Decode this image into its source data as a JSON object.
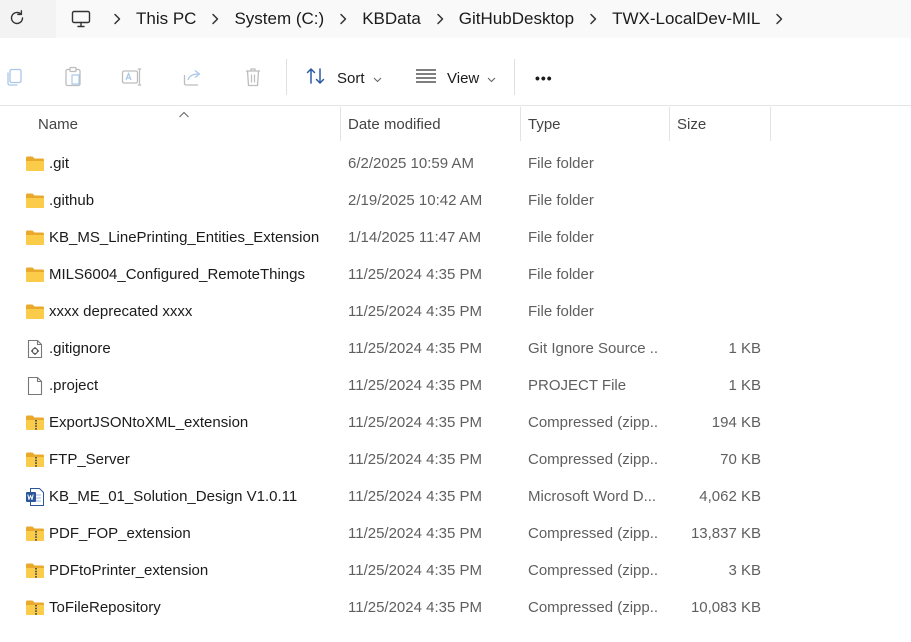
{
  "address_bar": {
    "segments": [
      "This PC",
      "System (C:)",
      "KBData",
      "GitHubDesktop",
      "TWX-LocalDev-MIL"
    ]
  },
  "toolbar": {
    "sort_label": "Sort",
    "view_label": "View",
    "more_label": "•••"
  },
  "columns": {
    "name": "Name",
    "date": "Date modified",
    "type": "Type",
    "size": "Size"
  },
  "files": [
    {
      "icon": "folder",
      "name": ".git",
      "date": "6/2/2025 10:59 AM",
      "type": "File folder",
      "size": ""
    },
    {
      "icon": "folder",
      "name": ".github",
      "date": "2/19/2025 10:42 AM",
      "type": "File folder",
      "size": ""
    },
    {
      "icon": "folder",
      "name": "KB_MS_LinePrinting_Entities_Extension",
      "date": "1/14/2025 11:47 AM",
      "type": "File folder",
      "size": ""
    },
    {
      "icon": "folder",
      "name": "MILS6004_Configured_RemoteThings",
      "date": "11/25/2024 4:35 PM",
      "type": "File folder",
      "size": ""
    },
    {
      "icon": "folder",
      "name": "xxxx deprecated xxxx",
      "date": "11/25/2024 4:35 PM",
      "type": "File folder",
      "size": ""
    },
    {
      "icon": "config",
      "name": ".gitignore",
      "date": "11/25/2024 4:35 PM",
      "type": "Git Ignore Source ...",
      "size": "1 KB"
    },
    {
      "icon": "file",
      "name": ".project",
      "date": "11/25/2024 4:35 PM",
      "type": "PROJECT File",
      "size": "1 KB"
    },
    {
      "icon": "zip",
      "name": "ExportJSONtoXML_extension",
      "date": "11/25/2024 4:35 PM",
      "type": "Compressed (zipp...",
      "size": "194 KB"
    },
    {
      "icon": "zip",
      "name": "FTP_Server",
      "date": "11/25/2024 4:35 PM",
      "type": "Compressed (zipp...",
      "size": "70 KB"
    },
    {
      "icon": "word",
      "name": "KB_ME_01_Solution_Design V1.0.11",
      "date": "11/25/2024 4:35 PM",
      "type": "Microsoft Word D...",
      "size": "4,062 KB"
    },
    {
      "icon": "zip",
      "name": "PDF_FOP_extension",
      "date": "11/25/2024 4:35 PM",
      "type": "Compressed (zipp...",
      "size": "13,837 KB"
    },
    {
      "icon": "zip",
      "name": "PDFtoPrinter_extension",
      "date": "11/25/2024 4:35 PM",
      "type": "Compressed (zipp...",
      "size": "3 KB"
    },
    {
      "icon": "zip",
      "name": "ToFileRepository",
      "date": "11/25/2024 4:35 PM",
      "type": "Compressed (zipp...",
      "size": "10,083 KB"
    }
  ]
}
